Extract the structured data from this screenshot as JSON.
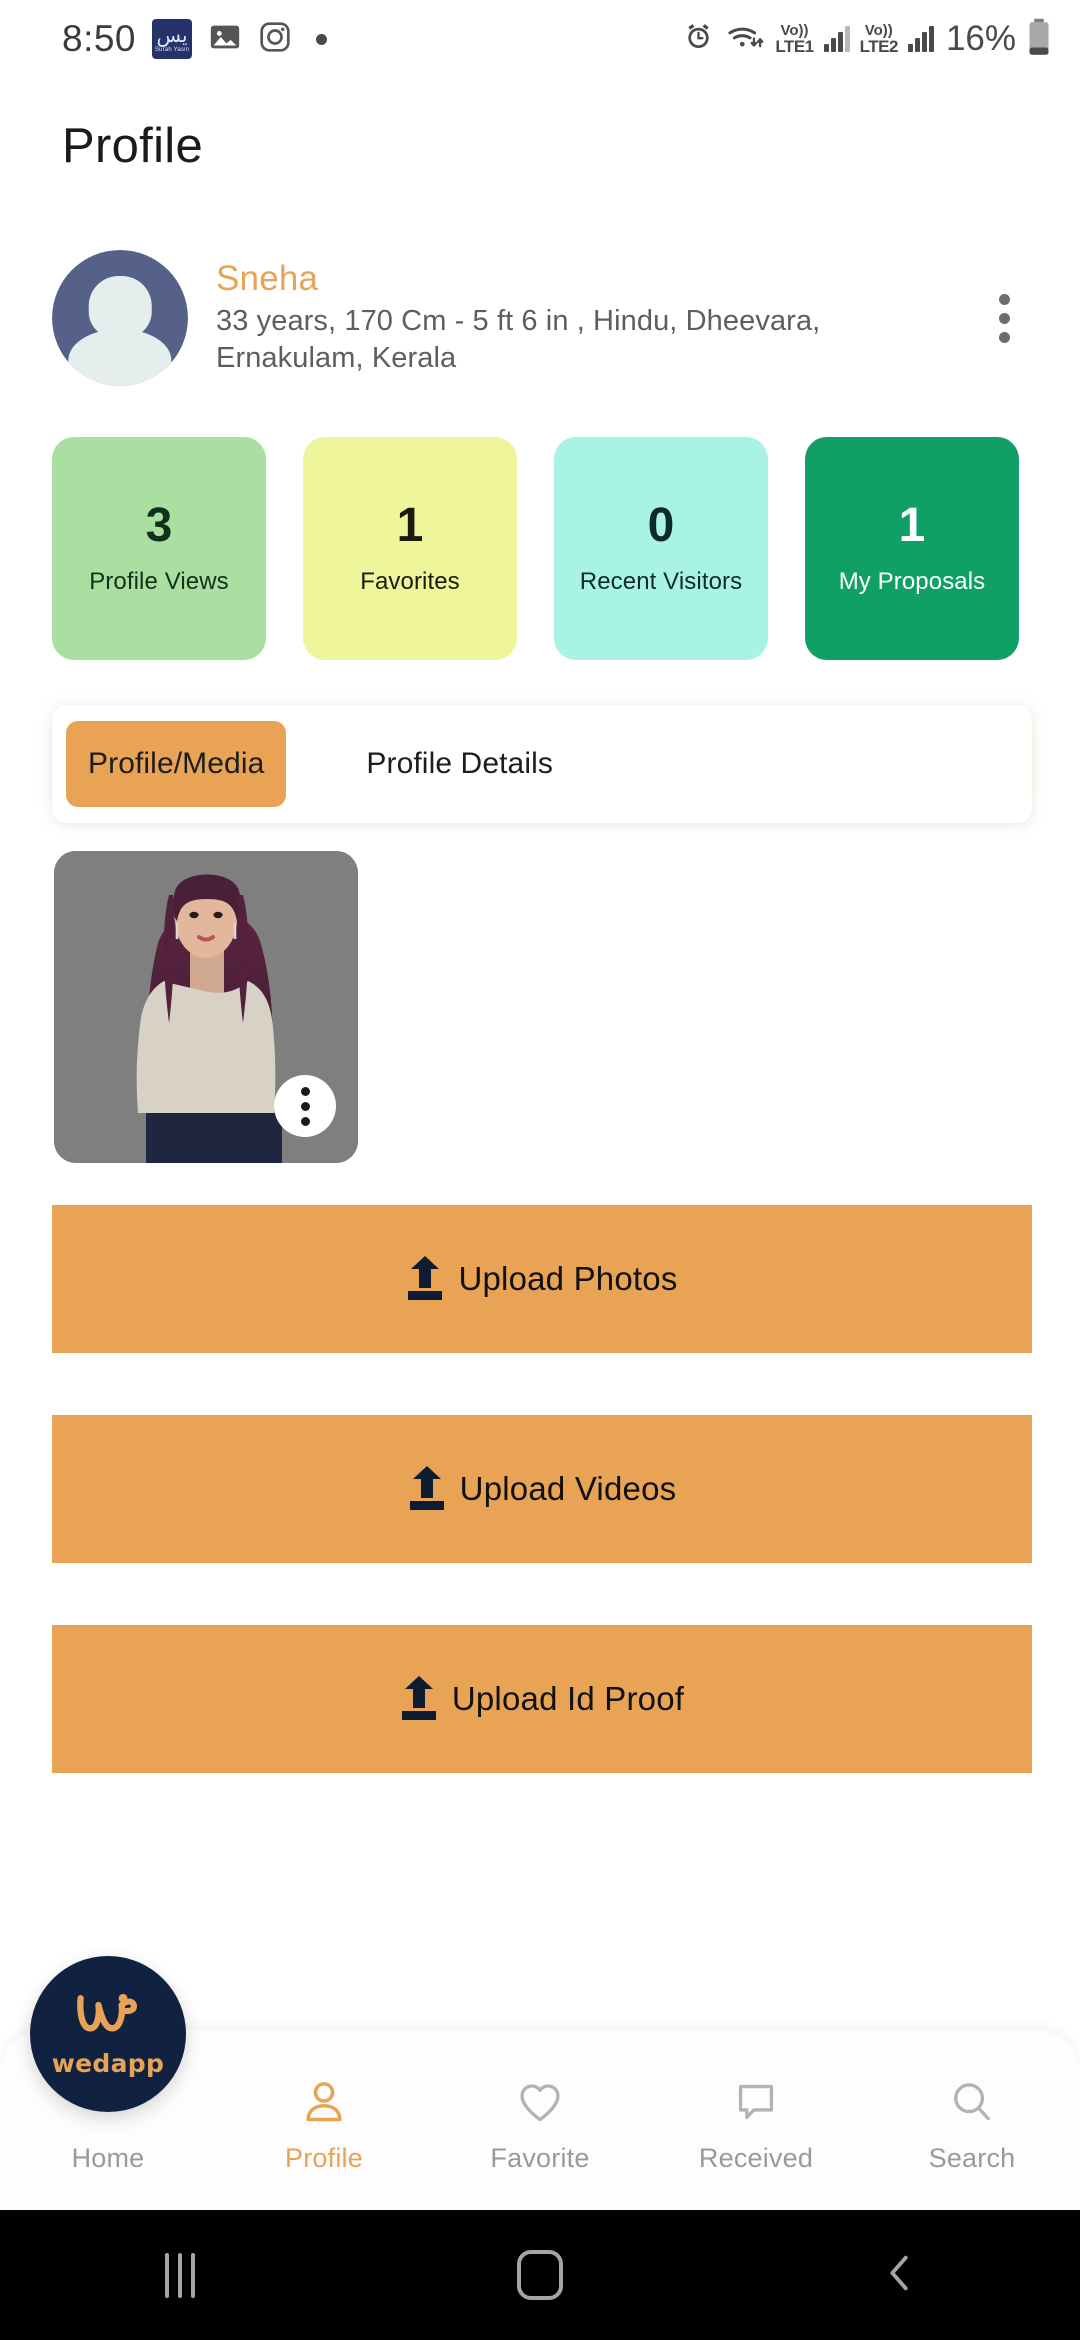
{
  "status_bar": {
    "time": "8:50",
    "app_badge": {
      "name": "surah-yasin-notification",
      "arabic": "يس",
      "latin": "Surah Yasin"
    },
    "icons": [
      "gallery-icon",
      "instagram-icon",
      "dot-indicator"
    ],
    "alarm": "alarm-icon",
    "wifi": "wifi-icon",
    "sim1": {
      "volte": "Vo))",
      "network": "LTE1"
    },
    "sim2": {
      "volte": "Vo))",
      "network": "LTE2"
    },
    "battery_percent": "16%"
  },
  "header": {
    "title": "Profile"
  },
  "profile": {
    "name": "Sneha",
    "details": "33 years, 170 Cm - 5 ft 6 in , Hindu, Dheevara, Ernakulam, Kerala",
    "avatar": "default-avatar-icon",
    "menu": "kebab-menu-icon"
  },
  "stats": [
    {
      "value": "3",
      "label": "Profile Views",
      "bg": "#a9e0a2",
      "fg": "#12301a"
    },
    {
      "value": "1",
      "label": "Favorites",
      "bg": "#eff59a",
      "fg": "#1b1b0d"
    },
    {
      "value": "0",
      "label": "Recent Visitors",
      "bg": "#a9f3e6",
      "fg": "#0f2b28"
    },
    {
      "value": "1",
      "label": "My Proposals",
      "bg": "#10a065",
      "fg": "#ffffff"
    }
  ],
  "tabs": [
    {
      "label": "Profile/Media",
      "active": true
    },
    {
      "label": "Profile Details",
      "active": false
    }
  ],
  "media": {
    "photo_menu": "kebab-menu-icon",
    "photo_alt": "profile-photo-thumbnail"
  },
  "uploads": [
    {
      "label": "Upload Photos",
      "icon": "upload-icon"
    },
    {
      "label": "Upload Videos",
      "icon": "upload-icon"
    },
    {
      "label": "Upload Id Proof",
      "icon": "upload-icon"
    }
  ],
  "brand": {
    "wordmark": "wedapp",
    "logo": "wedapp-logo-icon"
  },
  "bottom_nav": [
    {
      "label": "Home",
      "icon": "home-icon",
      "active": false
    },
    {
      "label": "Profile",
      "icon": "person-icon",
      "active": true
    },
    {
      "label": "Favorite",
      "icon": "heart-icon",
      "active": false
    },
    {
      "label": "Received",
      "icon": "chat-icon",
      "active": false
    },
    {
      "label": "Search",
      "icon": "search-icon",
      "active": false
    }
  ],
  "android_nav": [
    {
      "name": "recents-button"
    },
    {
      "name": "home-button"
    },
    {
      "name": "back-button"
    }
  ],
  "colors": {
    "accent": "#e8a355",
    "navy": "#112240",
    "muted": "#9a9a9a"
  }
}
